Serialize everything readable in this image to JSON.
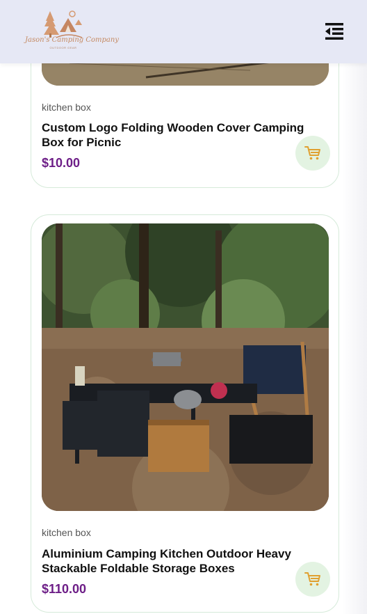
{
  "header": {
    "logo_text": "Jason's Camping Company",
    "logo_subtext": "OUTDOOR GEAR",
    "menu_icon": "menu-collapse-icon"
  },
  "products": [
    {
      "category": "kitchen box",
      "title": "Custom Logo Folding Wooden Cover Camping Box for Picnic",
      "price": "$10.00",
      "cart_icon": "cart-icon"
    },
    {
      "category": "kitchen box",
      "title": "Aluminium Camping Kitchen Outdoor Heavy Stackable Foldable Storage Boxes",
      "price": "$110.00",
      "cart_icon": "cart-icon"
    }
  ],
  "colors": {
    "header_bg": "#e6e8f5",
    "price": "#6d1e87",
    "cart_button_bg": "#e3f3e2",
    "cart_icon": "#e0a030",
    "card_border": "#d5ead9"
  }
}
